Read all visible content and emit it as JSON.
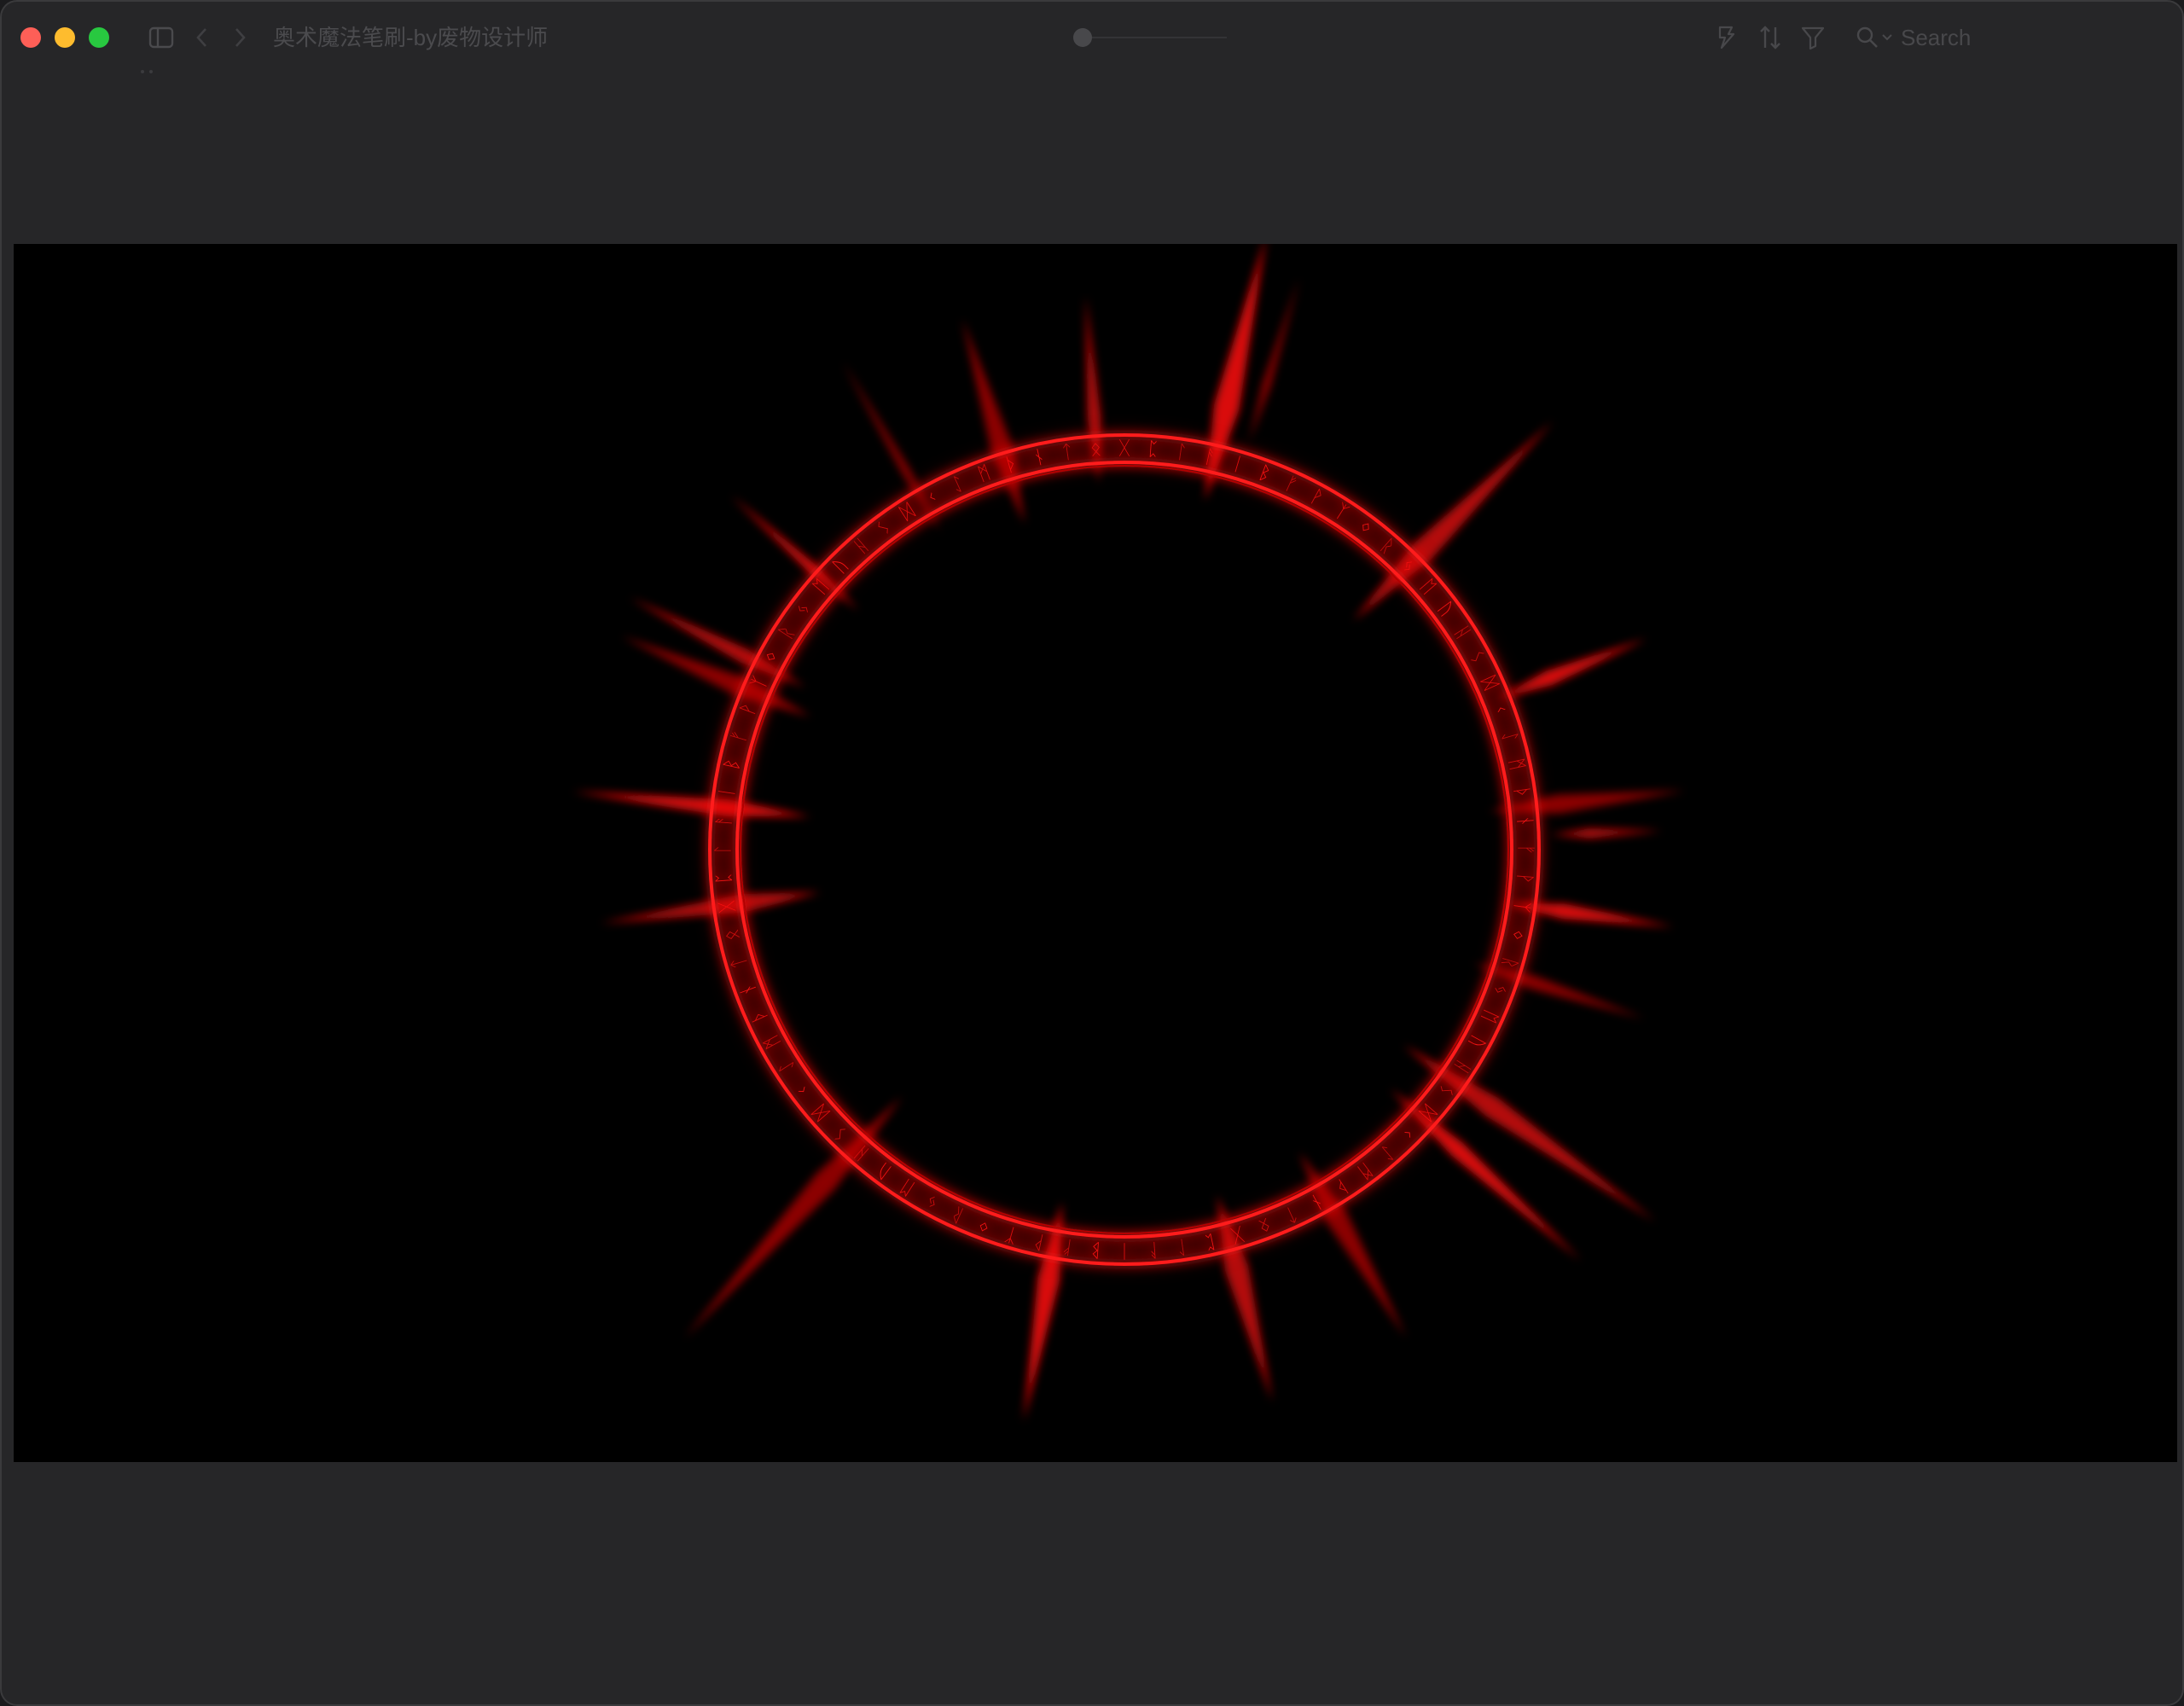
{
  "window": {
    "title": "奥术魔法笔刷-by废物设计师"
  },
  "toolbar": {
    "search_placeholder": "Search"
  },
  "icons": {
    "sidebar_toggle": "sidebar-icon",
    "back": "chevron-left-icon",
    "forward": "chevron-right-icon",
    "markup": "markup-icon",
    "sort": "sort-icon",
    "filter": "filter-icon",
    "search": "search-icon"
  },
  "colors": {
    "window_bg": "#262628",
    "canvas_bg": "#000000",
    "accent": "#ff1010",
    "close": "#fe5f57",
    "minimize": "#febc2e",
    "maximize": "#28c840"
  }
}
